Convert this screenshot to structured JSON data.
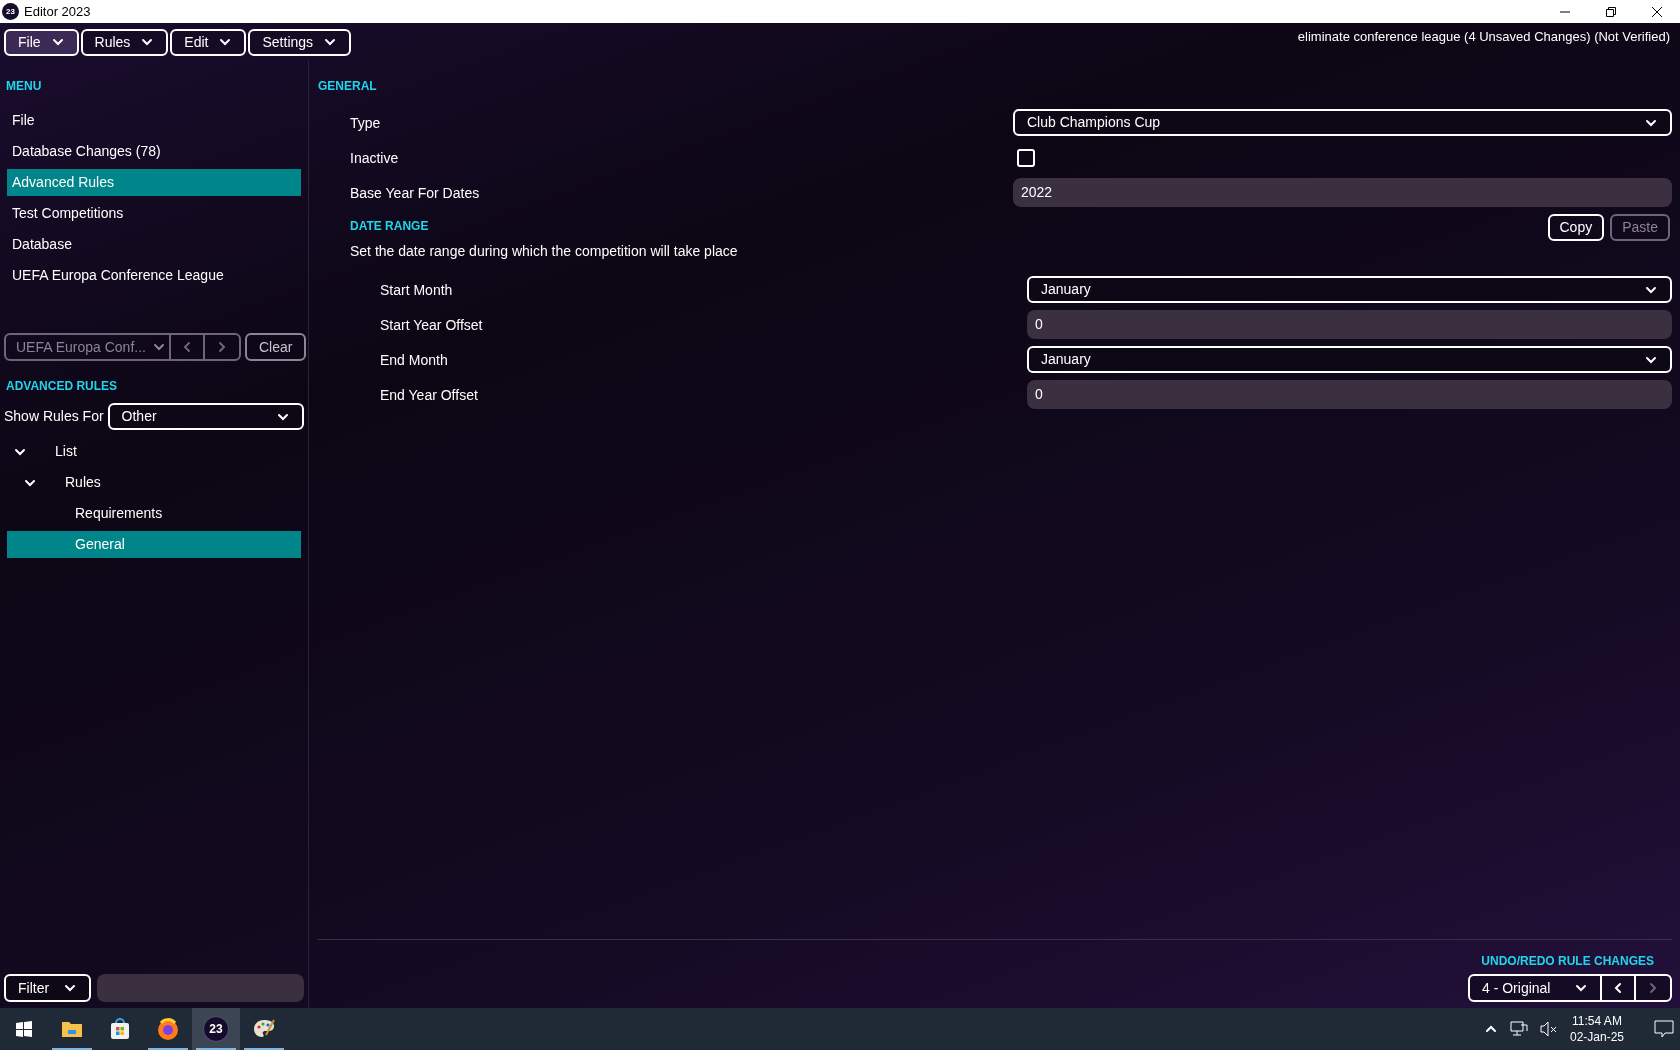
{
  "window": {
    "icon_text": "23",
    "title": "Editor 2023"
  },
  "menubar": [
    {
      "label": "File",
      "selected": true
    },
    {
      "label": "Rules",
      "selected": false
    },
    {
      "label": "Edit",
      "selected": false
    },
    {
      "label": "Settings",
      "selected": false
    }
  ],
  "status_text": "eliminate conference league (4 Unsaved Changes) (Not Verified)",
  "sidebar": {
    "menu_header": "MENU",
    "menu_items": [
      {
        "label": "File",
        "selected": false
      },
      {
        "label": "Database Changes (78)",
        "selected": false
      },
      {
        "label": "Advanced Rules",
        "selected": true
      },
      {
        "label": "Test Competitions",
        "selected": false
      },
      {
        "label": "Database",
        "selected": false
      },
      {
        "label": "UEFA Europa Conference League",
        "selected": false
      }
    ],
    "picker": {
      "value": "UEFA Europa Conf...",
      "disabled": true
    },
    "clear_button": {
      "label": "Clear",
      "disabled": false
    },
    "rules_header": "ADVANCED RULES",
    "show_rules_for": {
      "label": "Show Rules For",
      "value": "Other"
    },
    "tree": [
      {
        "label": "List",
        "expanded": true,
        "selected": false,
        "children": [
          {
            "label": "Rules",
            "expanded": true,
            "selected": false,
            "children": [
              {
                "label": "Requirements",
                "selected": false
              },
              {
                "label": "General",
                "selected": true
              }
            ]
          }
        ]
      }
    ],
    "filter": {
      "label": "Filter"
    }
  },
  "general": {
    "header": "GENERAL",
    "fields": [
      {
        "kind": "dropdown",
        "label": "Type",
        "value": "Club Champions Cup"
      },
      {
        "kind": "checkbox",
        "label": "Inactive",
        "checked": false
      },
      {
        "kind": "text",
        "label": "Base Year For Dates",
        "value": "2022"
      }
    ]
  },
  "date_range": {
    "header": "DATE RANGE",
    "buttons": [
      {
        "label": "Copy",
        "disabled": false
      },
      {
        "label": "Paste",
        "disabled": true
      }
    ],
    "description": "Set the date range during which the competition will take place",
    "fields": [
      {
        "kind": "dropdown",
        "label": "Start Month",
        "value": "January"
      },
      {
        "kind": "text",
        "label": "Start Year Offset",
        "value": "0"
      },
      {
        "kind": "dropdown",
        "label": "End Month",
        "value": "January"
      },
      {
        "kind": "text",
        "label": "End Year Offset",
        "value": "0"
      }
    ]
  },
  "undo": {
    "header": "UNDO/REDO RULE CHANGES",
    "value": "4 - Original",
    "prev_disabled": false,
    "next_disabled": true
  },
  "taskbar": {
    "apps": [
      {
        "kind": "folder",
        "running": true,
        "selected": false
      },
      {
        "kind": "store",
        "running": false,
        "selected": false
      },
      {
        "kind": "browser",
        "running": true,
        "selected": false
      },
      {
        "kind": "editor",
        "label": "23",
        "running": true,
        "selected": true
      },
      {
        "kind": "paint",
        "running": true,
        "selected": false
      }
    ],
    "time": "11:54 AM",
    "date": "02-Jan-25"
  }
}
